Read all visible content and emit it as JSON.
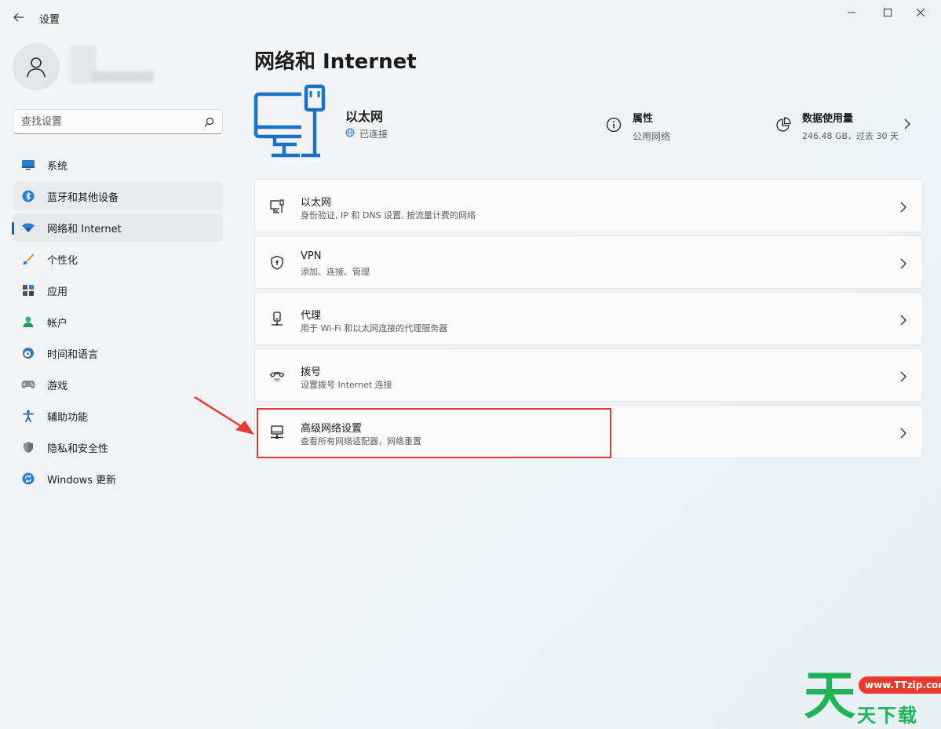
{
  "window": {
    "app_title": "设置",
    "controls": {
      "minimize": "—",
      "maximize": "□",
      "close": "✕"
    }
  },
  "sidebar": {
    "search_placeholder": "查找设置",
    "items": [
      {
        "label": "系统",
        "icon": "monitor-icon",
        "state": "normal"
      },
      {
        "label": "蓝牙和其他设备",
        "icon": "bluetooth-icon",
        "state": "hover"
      },
      {
        "label": "网络和 Internet",
        "icon": "wifi-icon",
        "state": "selected"
      },
      {
        "label": "个性化",
        "icon": "brush-icon",
        "state": "normal"
      },
      {
        "label": "应用",
        "icon": "apps-icon",
        "state": "normal"
      },
      {
        "label": "帐户",
        "icon": "person-icon",
        "state": "normal"
      },
      {
        "label": "时间和语言",
        "icon": "clock-globe-icon",
        "state": "normal"
      },
      {
        "label": "游戏",
        "icon": "gamepad-icon",
        "state": "normal"
      },
      {
        "label": "辅助功能",
        "icon": "accessibility-icon",
        "state": "normal"
      },
      {
        "label": "隐私和安全性",
        "icon": "shield-icon",
        "state": "normal"
      },
      {
        "label": "Windows 更新",
        "icon": "update-icon",
        "state": "normal"
      }
    ]
  },
  "main": {
    "page_title": "网络和 Internet",
    "hero": {
      "name": "以太网",
      "status": "已连接",
      "properties": {
        "title": "属性",
        "subtitle": "公用网络"
      },
      "data_usage": {
        "title": "数据使用量",
        "subtitle": "246.48 GB，过去 30 天"
      }
    },
    "cards": [
      {
        "title": "以太网",
        "subtitle": "身份验证, IP 和 DNS 设置, 按流量计费的网络",
        "icon": "ethernet-icon"
      },
      {
        "title": "VPN",
        "subtitle": "添加、连接、管理",
        "icon": "vpn-shield-icon"
      },
      {
        "title": "代理",
        "subtitle": "用于 Wi-Fi 和以太网连接的代理服务器",
        "icon": "proxy-icon"
      },
      {
        "title": "拨号",
        "subtitle": "设置拨号 Internet 连接",
        "icon": "dialup-phone-icon"
      },
      {
        "title": "高级网络设置",
        "subtitle": "查看所有网络适配器，网络重置",
        "icon": "network-adapter-icon"
      }
    ]
  },
  "annotation": {
    "color": "#e53935",
    "target": "高级网络设置"
  },
  "colors": {
    "accent": "#0067c0",
    "hero_icon": "#1a73c8"
  },
  "watermark": {
    "big": "天",
    "badge": "www.TTzip.com",
    "small": "天下载"
  }
}
